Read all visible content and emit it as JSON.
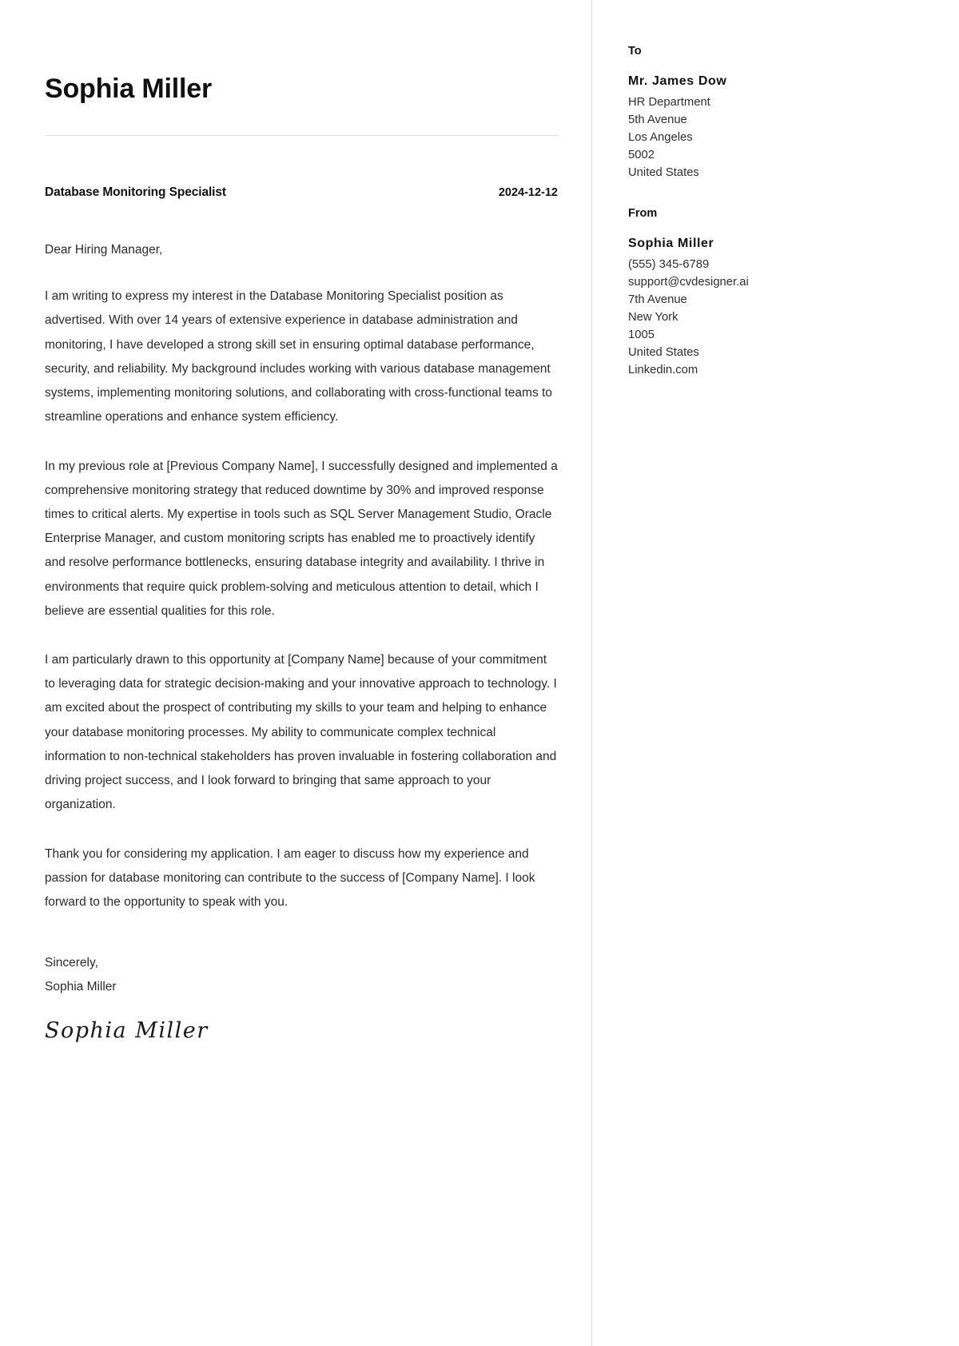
{
  "letter": {
    "name": "Sophia Miller",
    "job_title": "Database Monitoring Specialist",
    "date": "2024-12-12",
    "salutation": "Dear Hiring Manager,",
    "paragraphs": [
      "I am writing to express my interest in the Database Monitoring Specialist position as advertised. With over 14 years of extensive experience in database administration and monitoring, I have developed a strong skill set in ensuring optimal database performance, security, and reliability. My background includes working with various database management systems, implementing monitoring solutions, and collaborating with cross-functional teams to streamline operations and enhance system efficiency.",
      "In my previous role at [Previous Company Name], I successfully designed and implemented a comprehensive monitoring strategy that reduced downtime by 30% and improved response times to critical alerts. My expertise in tools such as SQL Server Management Studio, Oracle Enterprise Manager, and custom monitoring scripts has enabled me to proactively identify and resolve performance bottlenecks, ensuring database integrity and availability. I thrive in environments that require quick problem-solving and meticulous attention to detail, which I believe are essential qualities for this role.",
      "I am particularly drawn to this opportunity at [Company Name] because of your commitment to leveraging data for strategic decision-making and your innovative approach to technology. I am excited about the prospect of contributing my skills to your team and helping to enhance your database monitoring processes. My ability to communicate complex technical information to non-technical stakeholders has proven invaluable in fostering collaboration and driving project success, and I look forward to bringing that same approach to your organization.",
      "Thank you for considering my application. I am eager to discuss how my experience and passion for database monitoring can contribute to the success of [Company Name]. I look forward to the opportunity to speak with you."
    ],
    "closing_salutation": "Sincerely,",
    "closing_name": "Sophia Miller",
    "signature": "Sophia Miller"
  },
  "contact": {
    "to": {
      "heading": "To",
      "person": "Mr. James Dow",
      "lines": [
        "HR Department",
        "5th Avenue",
        "Los Angeles",
        "5002",
        "United States"
      ]
    },
    "from": {
      "heading": "From",
      "person": "Sophia Miller",
      "lines": [
        "(555) 345-6789",
        "support@cvdesigner.ai",
        "7th Avenue",
        "New York",
        "1005",
        "United States",
        "Linkedin.com"
      ]
    }
  },
  "colors": {
    "text": "#1a1a1a",
    "body_text": "#2b2b2b",
    "rule": "#dcdcdc",
    "divider": "#d8d8d8",
    "page_background": "#ffffff"
  }
}
